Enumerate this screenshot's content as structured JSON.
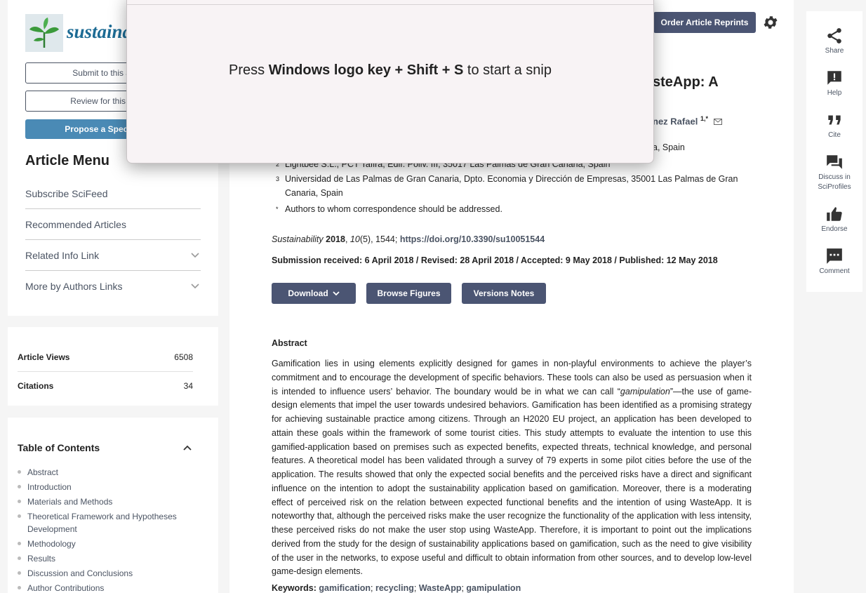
{
  "journal": {
    "logo_text": "sustainability"
  },
  "left_menu": {
    "submit_btn": "Submit to this Journal",
    "review_btn": "Review for this Journal",
    "propose_btn": "Propose a Special Issue",
    "menu_title": "Article Menu",
    "items": [
      {
        "label": "Subscribe SciFeed"
      },
      {
        "label": "Recommended Articles"
      },
      {
        "label": "Related Info Link"
      },
      {
        "label": "More by Authors Links"
      }
    ]
  },
  "metrics": {
    "views_label": "Article Views",
    "views_value": "6508",
    "citations_label": "Citations",
    "citations_value": "34"
  },
  "toc": {
    "title": "Table of Contents",
    "items": [
      "Abstract",
      "Introduction",
      "Materials and Methods",
      "Theoretical Framework and Hypotheses Development",
      "Methodology",
      "Results",
      "Discussion and Conclusions",
      "Author Contributions"
    ]
  },
  "header": {
    "reprints_btn": "Order Article Reprints",
    "title_fragment": "steApp: A",
    "author_fragment": "nez Rafael",
    "author_sup": "1,*"
  },
  "affiliations": {
    "a1_tail": "a, Spain",
    "a2_num": "2",
    "a2": "Lightbee S.L., PCT Tafira, Edif. Poliv. III, 35017 Las Palmas de Gran Canaria, Spain",
    "a3_num": "3",
    "a3": "Universidad de Las Palmas de Gran Canaria, Dpto. Economia y Dirección de Empresas, 35001 Las Palmas de Gran Canaria, Spain",
    "corr_num": "*",
    "corr": "Authors to whom correspondence should be addressed."
  },
  "citation": {
    "journal": "Sustainability",
    "year": "2018",
    "volume": "10",
    "issue_pages": "(5), 1544;",
    "doi": "https://doi.org/10.3390/su10051544"
  },
  "dates": "Submission received: 6 April 2018 / Revised: 28 April 2018 / Accepted: 9 May 2018 / Published: 12 May 2018",
  "actions": {
    "download": "Download",
    "browse": "Browse Figures",
    "versions": "Versions Notes"
  },
  "abstract": {
    "heading": "Abstract",
    "text_before": "Gamification lies in using elements explicitly designed for games in non-playful environments to achieve the player’s commitment and to encourage the development of specific behaviors. These tools can also be used as persuasion when it is intended to influence users’ behavior. The boundary would be in what we can call “",
    "text_em": "gamipulation",
    "text_after": "”—the use of game-design elements that impel the user towards undesired behaviors. Gamification has been identified as a promising strategy for achieving sustainable practice among citizens. Through an H2020 EU project, an application has been developed to attain these goals within the framework of some tourist cities. This study attempts to evaluate the intention to use this gamified-application based on premises such as expected benefits, expected threats, technical knowledge, and personal features. A theoretical model has been validated through a survey of 79 experts in some pilot cities before the use of the application. The results showed that only the expected social benefits and the perceived risks have a direct and significant influence on the intention to adopt the sustainability application based on gamification. Moreover, there is a moderating effect of perceived risk on the relation between expected functional benefits and the intention of using WasteApp. It is noteworthy that, although the perceived risks make the user recognize the functionality of the application with less intensity, these perceived risks do not make the user stop using WasteApp. Therefore, it is important to point out the implications derived from the study for the design of sustainability applications based on gamification, such as the need to give visibility of the user in the networks, to expose useful and difficult to obtain information from other sources, and to develop low-level game-design elements."
  },
  "keywords": {
    "label": "Keywords:",
    "items": [
      "gamification",
      "recycling",
      "WasteApp",
      "gamipulation"
    ]
  },
  "right_bar": {
    "share": "Share",
    "help": "Help",
    "cite": "Cite",
    "discuss": "Discuss in SciProfiles",
    "endorse": "Endorse",
    "comment": "Comment"
  },
  "snip": {
    "prefix": "Press ",
    "keys": "Windows logo key + Shift + S",
    "suffix": " to start a snip"
  },
  "colors": {
    "accent": "#4b5573",
    "link": "#4b5463",
    "propose": "#4a8ab5",
    "brand": "#1c6b94"
  }
}
